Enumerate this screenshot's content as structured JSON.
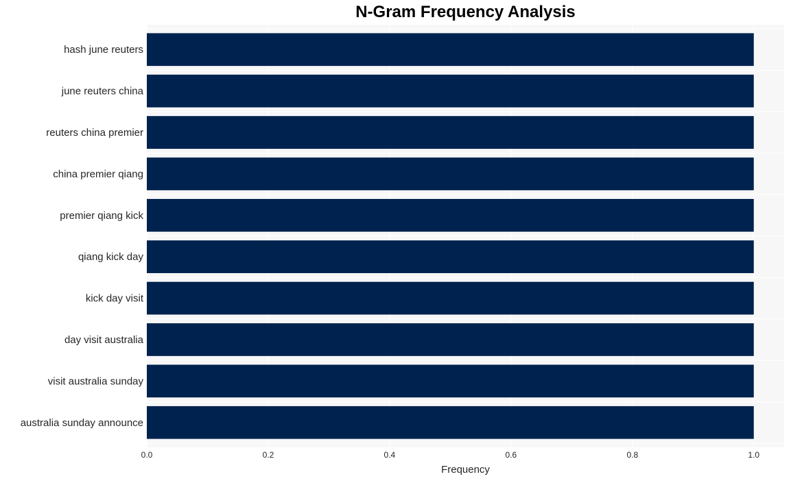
{
  "chart_data": {
    "type": "bar",
    "orientation": "horizontal",
    "title": "N-Gram Frequency Analysis",
    "xlabel": "Frequency",
    "ylabel": "",
    "categories": [
      "hash june reuters",
      "june reuters china",
      "reuters china premier",
      "china premier qiang",
      "premier qiang kick",
      "qiang kick day",
      "kick day visit",
      "day visit australia",
      "visit australia sunday",
      "australia sunday announce"
    ],
    "values": [
      1,
      1,
      1,
      1,
      1,
      1,
      1,
      1,
      1,
      1
    ],
    "xlim": [
      0,
      1.05
    ],
    "xticks": [
      0.0,
      0.2,
      0.4,
      0.6,
      0.8,
      1.0
    ],
    "xtick_labels": [
      "0.0",
      "0.2",
      "0.4",
      "0.6",
      "0.8",
      "1.0"
    ],
    "grid": true,
    "legend": "none",
    "colors": {
      "bar": "#00224e",
      "plot_background": "#f7f7f7",
      "grid": "#ffffff"
    }
  }
}
